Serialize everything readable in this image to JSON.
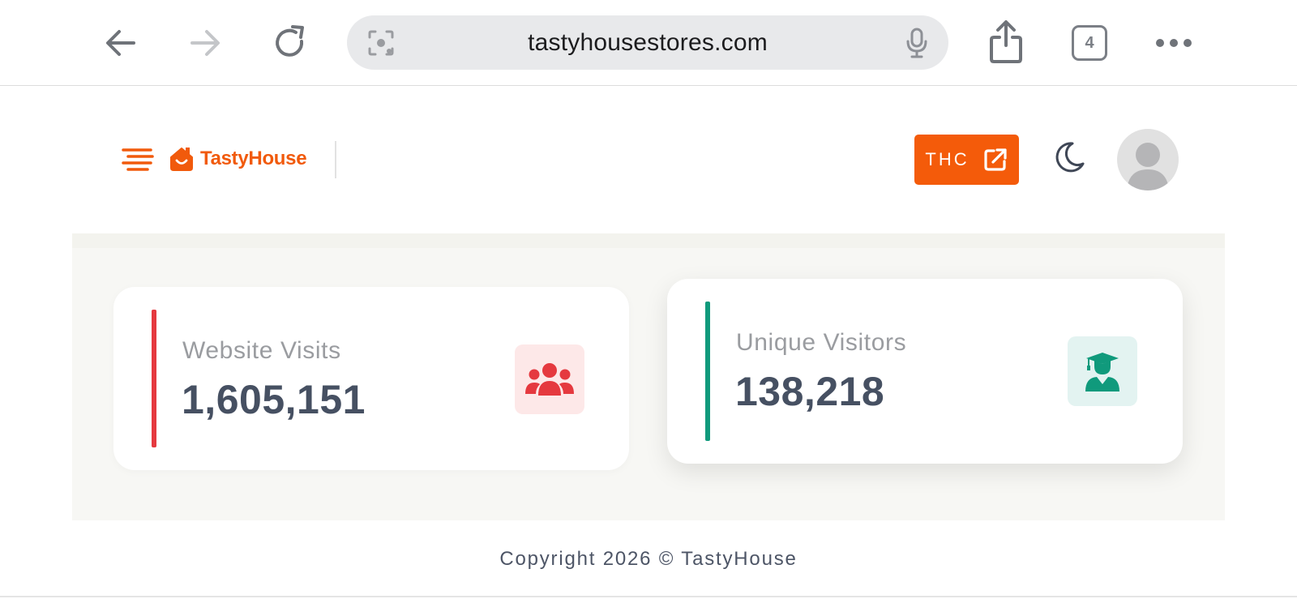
{
  "browser": {
    "url": "tastyhousestores.com",
    "tab_count": "4"
  },
  "header": {
    "brand": "TastyHouse",
    "thc_label": "THC"
  },
  "stats": [
    {
      "label": "Website Visits",
      "value": "1,605,151",
      "accent": "#e5393f",
      "icon": "users-icon",
      "icon_bg": "#fde8e8",
      "icon_color": "#e5393f"
    },
    {
      "label": "Unique Visitors",
      "value": "138,218",
      "accent": "#109a7c",
      "icon": "graduate-icon",
      "icon_bg": "#e3f3f1",
      "icon_color": "#109a7c"
    }
  ],
  "footer": {
    "copyright": "Copyright 2026 © TastyHouse"
  },
  "colors": {
    "brand": "#f45b0a",
    "text_dark": "#465062"
  }
}
